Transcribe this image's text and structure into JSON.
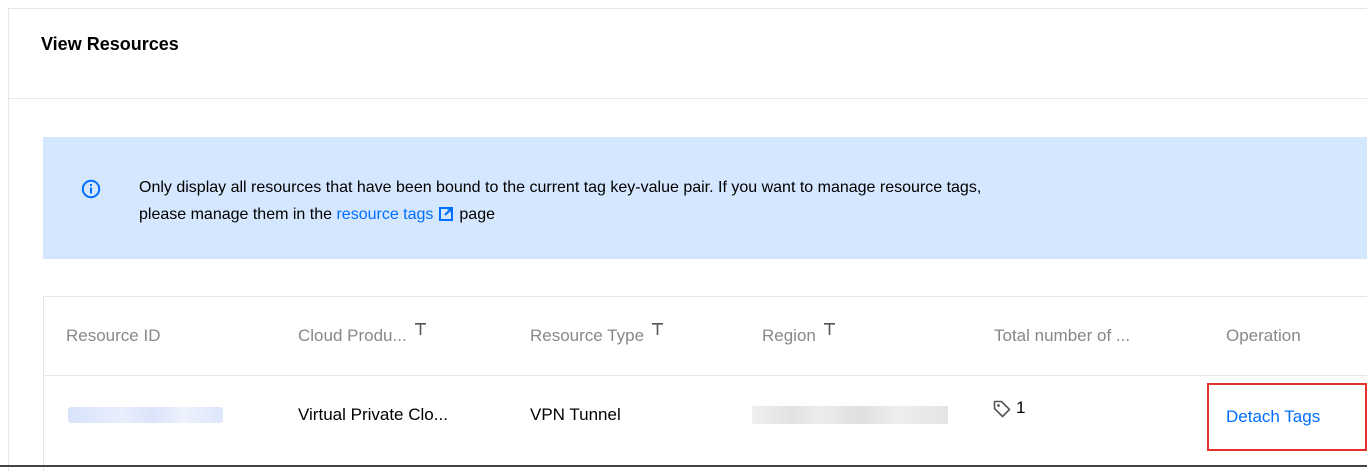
{
  "header": {
    "title": "View Resources"
  },
  "notice": {
    "icon": "info-circle-icon",
    "line1": "Only display all resources that have been bound to the current tag key-value pair. If you want to manage resource tags,",
    "line2_prefix": "please manage them in the ",
    "link_text": "resource tags",
    "line2_suffix": "page",
    "background": "#d5e7ff",
    "accent": "#006eff"
  },
  "table": {
    "columns": [
      {
        "label": "Resource ID",
        "filterable": false
      },
      {
        "label": "Cloud Produ...",
        "filterable": true
      },
      {
        "label": "Resource Type",
        "filterable": true
      },
      {
        "label": "Region",
        "filterable": true
      },
      {
        "label": "Total number of ...",
        "filterable": false
      },
      {
        "label": "Operation",
        "filterable": false
      }
    ],
    "rows": [
      {
        "resource_id": "",
        "cloud_product": "Virtual Private Clo...",
        "resource_type": "VPN Tunnel",
        "region": "",
        "tag_count": "1",
        "operation": "Detach Tags"
      }
    ],
    "highlight_color": "#e5312e"
  }
}
